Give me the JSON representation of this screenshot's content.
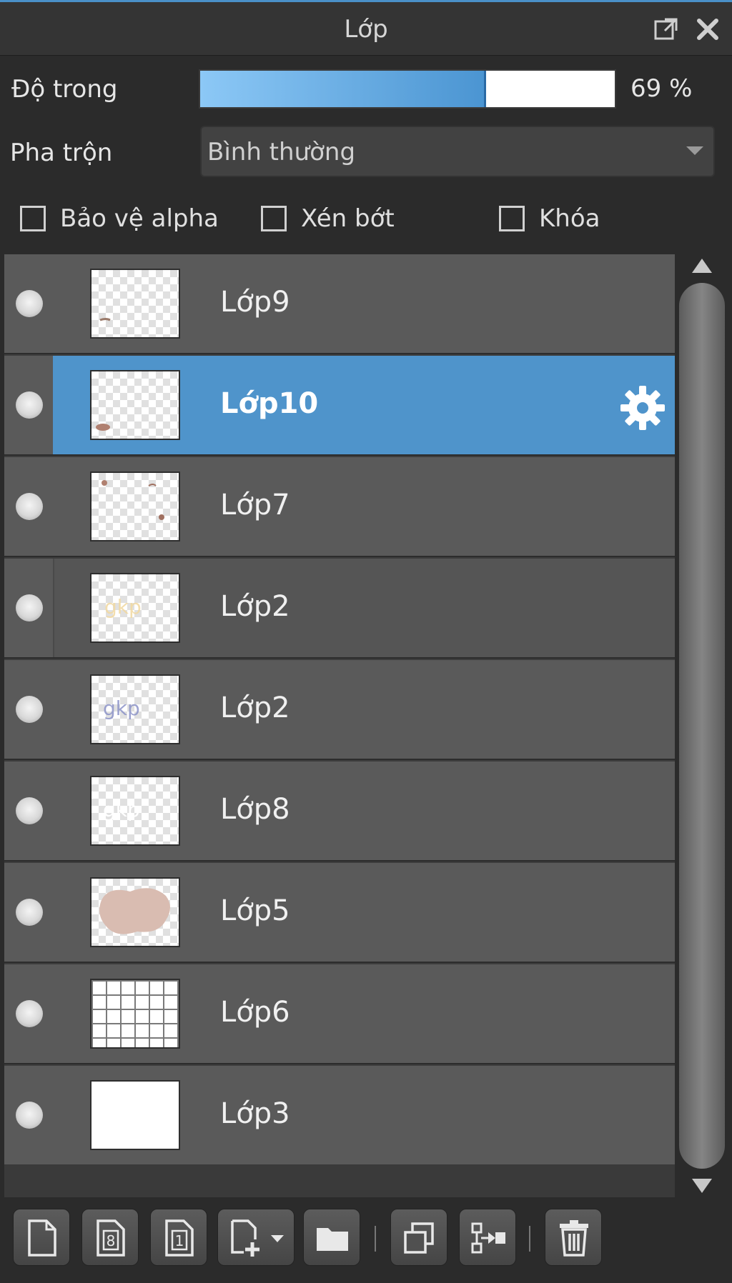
{
  "panel": {
    "title": "Lớp",
    "accent_color": "#4f94cb"
  },
  "opacity": {
    "label": "Độ trong",
    "value_text": "69 %",
    "value_percent": 69
  },
  "blend": {
    "label": "Pha trộn",
    "selected": "Bình thường"
  },
  "options": [
    {
      "label": "Bảo vệ alpha",
      "checked": false
    },
    {
      "label": "Xén bớt",
      "checked": false
    },
    {
      "label": "Khóa",
      "checked": false
    }
  ],
  "layers": [
    {
      "name": "Lớp9",
      "state": "normal",
      "thumb": "sparse"
    },
    {
      "name": "Lớp10",
      "state": "selected",
      "thumb": "blob-small"
    },
    {
      "name": "Lớp7",
      "state": "normal",
      "thumb": "dots"
    },
    {
      "name": "Lớp2",
      "state": "sub",
      "thumb": "yellow-text"
    },
    {
      "name": "Lớp2",
      "state": "normal",
      "thumb": "blue-text"
    },
    {
      "name": "Lớp8",
      "state": "normal",
      "thumb": "white-text"
    },
    {
      "name": "Lớp5",
      "state": "normal",
      "thumb": "pink-blob"
    },
    {
      "name": "Lớp6",
      "state": "normal",
      "thumb": "grid"
    },
    {
      "name": "Lớp3",
      "state": "normal",
      "thumb": "solid-white"
    }
  ],
  "toolbar": {
    "icons": [
      "new-layer-icon",
      "new-8bit-layer-icon",
      "new-1bit-layer-icon",
      "add-layer-menu-icon",
      "new-folder-icon",
      "duplicate-layer-icon",
      "merge-down-icon",
      "delete-layer-icon"
    ]
  }
}
